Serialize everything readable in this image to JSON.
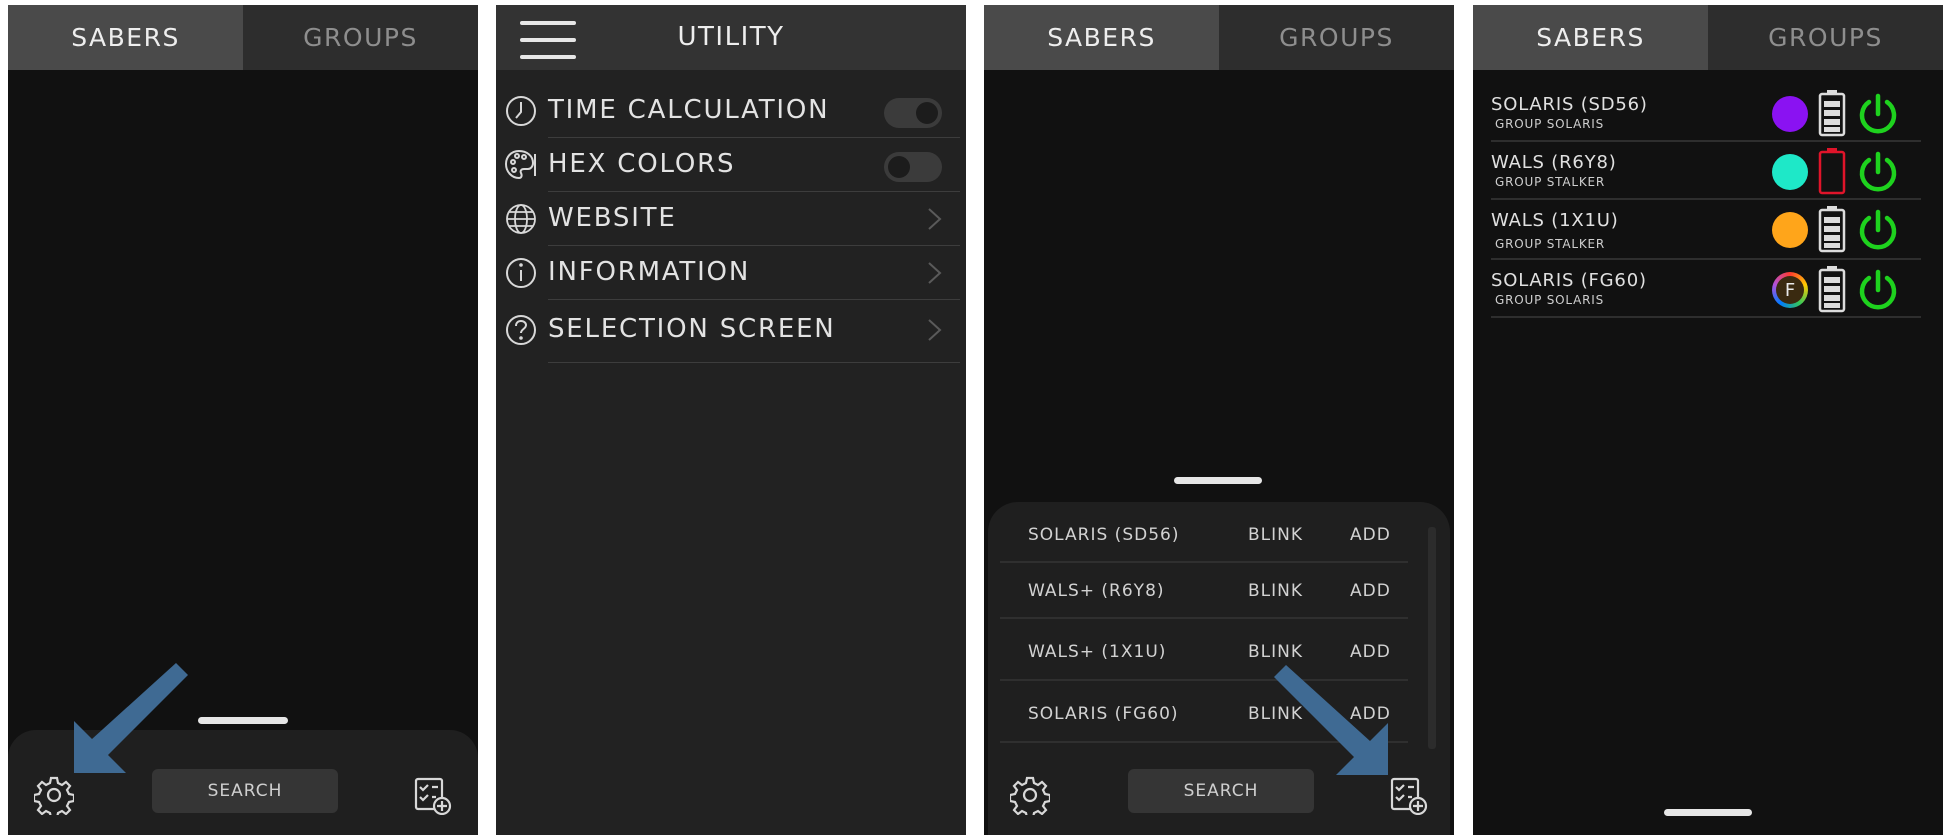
{
  "colors": {
    "accent_arrow": "#3f6a93",
    "power_green": "#1ed21e",
    "battery_low": "#e0142a"
  },
  "screen1": {
    "tabs": [
      {
        "label": "SABERS",
        "active": true
      },
      {
        "label": "GROUPS",
        "active": false
      }
    ],
    "search_label": "SEARCH",
    "icons": {
      "settings": "gear-icon",
      "add": "checklist-add-icon"
    }
  },
  "screen2": {
    "title": "UTILITY",
    "rows": [
      {
        "label": "TIME CALCULATION",
        "icon": "clock-icon",
        "control": "toggle",
        "on": true
      },
      {
        "label": "HEX COLORS",
        "icon": "palette-icon",
        "control": "toggle",
        "on": false
      },
      {
        "label": "WEBSITE",
        "icon": "globe-icon",
        "control": "chevron"
      },
      {
        "label": "INFORMATION",
        "icon": "info-icon",
        "control": "chevron"
      },
      {
        "label": "SELECTION SCREEN",
        "icon": "help-icon",
        "control": "chevron"
      }
    ]
  },
  "screen3": {
    "tabs": [
      {
        "label": "SABERS",
        "active": true
      },
      {
        "label": "GROUPS",
        "active": false
      }
    ],
    "search_label": "SEARCH",
    "devices": [
      {
        "name": "SOLARIS (SD56)",
        "blink": "BLINK",
        "add": "ADD"
      },
      {
        "name": "WALS+ (R6Y8)",
        "blink": "BLINK",
        "add": "ADD"
      },
      {
        "name": "WALS+ (1X1U)",
        "blink": "BLINK",
        "add": "ADD"
      },
      {
        "name": "SOLARIS (FG60)",
        "blink": "BLINK",
        "add": "ADD"
      }
    ]
  },
  "screen4": {
    "tabs": [
      {
        "label": "SABERS",
        "active": true
      },
      {
        "label": "GROUPS",
        "active": false
      }
    ],
    "sabers": [
      {
        "name": "SOLARIS (SD56)",
        "group": "GROUP SOLARIS",
        "color": "#8a12f2",
        "battery": "full"
      },
      {
        "name": "WALS (R6Y8)",
        "group": "GROUP STALKER",
        "color": "#1ee8c8",
        "battery": "low"
      },
      {
        "name": "WALS (1X1U)",
        "group": "GROUP STALKER",
        "color": "#ffa51a",
        "battery": "full"
      },
      {
        "name": "SOLARIS (FG60)",
        "group": "GROUP SOLARIS",
        "color": "multicolor",
        "badge": "F",
        "battery": "full"
      }
    ]
  }
}
